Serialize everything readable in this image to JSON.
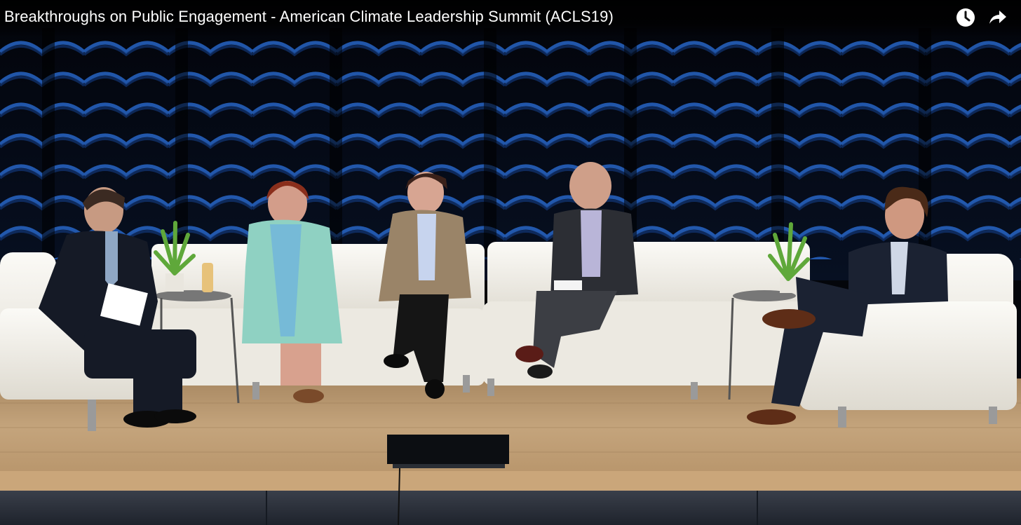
{
  "player": {
    "title": "Breakthroughs on Public Engagement - American Climate Leadership Summit (ACLS19)",
    "controls": [
      {
        "name": "watch-later",
        "icon": "clock-icon"
      },
      {
        "name": "share",
        "icon": "share-arrow-icon"
      }
    ]
  },
  "scene": {
    "description_colors": {
      "curtain": "#0a1a3a",
      "curtain_highlight": "#2a6ed8",
      "sofa": "#f2f0ea",
      "stage_floor": "#b99a72"
    }
  }
}
